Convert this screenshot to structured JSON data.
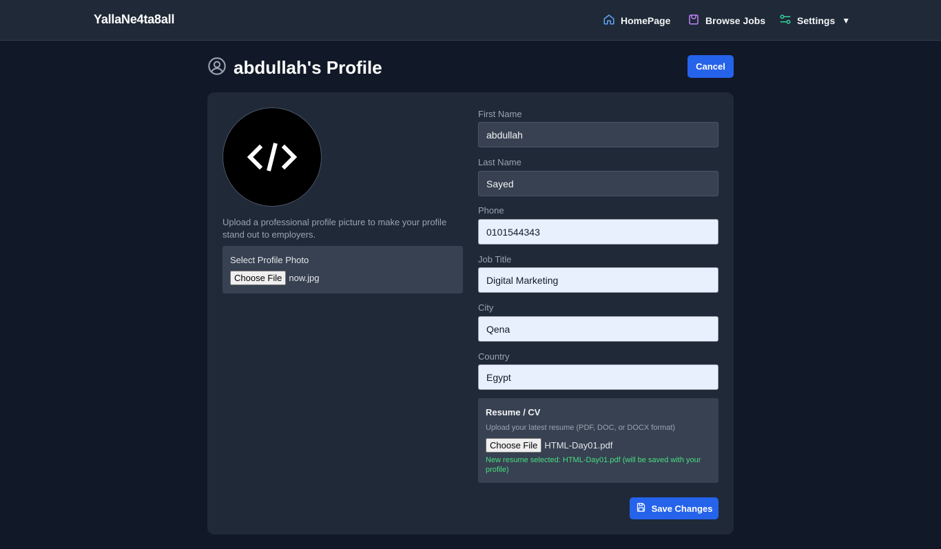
{
  "nav": {
    "brand": "YallaNe4ta8all",
    "home_label": "HomePage",
    "jobs_label": "Browse Jobs",
    "settings_label": "Settings",
    "settings_caret": "▼"
  },
  "header": {
    "title": "abdullah's Profile",
    "cancel_label": "Cancel"
  },
  "photo": {
    "hint": "Upload a professional profile picture to make your profile stand out to employers.",
    "select_label": "Select Profile Photo",
    "choose_label": "Choose File",
    "file_name": "now.jpg"
  },
  "form": {
    "first_name_label": "First Name",
    "first_name_value": "abdullah",
    "last_name_label": "Last Name",
    "last_name_value": "Sayed",
    "phone_label": "Phone",
    "phone_value": "0101544343",
    "job_title_label": "Job Title",
    "job_title_value": "Digital Marketing",
    "city_label": "City",
    "city_value": "Qena",
    "country_label": "Country",
    "country_value": "Egypt"
  },
  "resume": {
    "title": "Resume / CV",
    "hint": "Upload your latest resume (PDF, DOC, or DOCX format)",
    "choose_label": "Choose File",
    "file_name": "HTML-Day01.pdf",
    "status": "New resume selected: HTML-Day01.pdf (will be saved with your profile)"
  },
  "save_label": "Save Changes",
  "colors": {
    "background": "#111827",
    "card": "#1f2937",
    "accent": "#2563eb",
    "success": "#4ade80"
  }
}
